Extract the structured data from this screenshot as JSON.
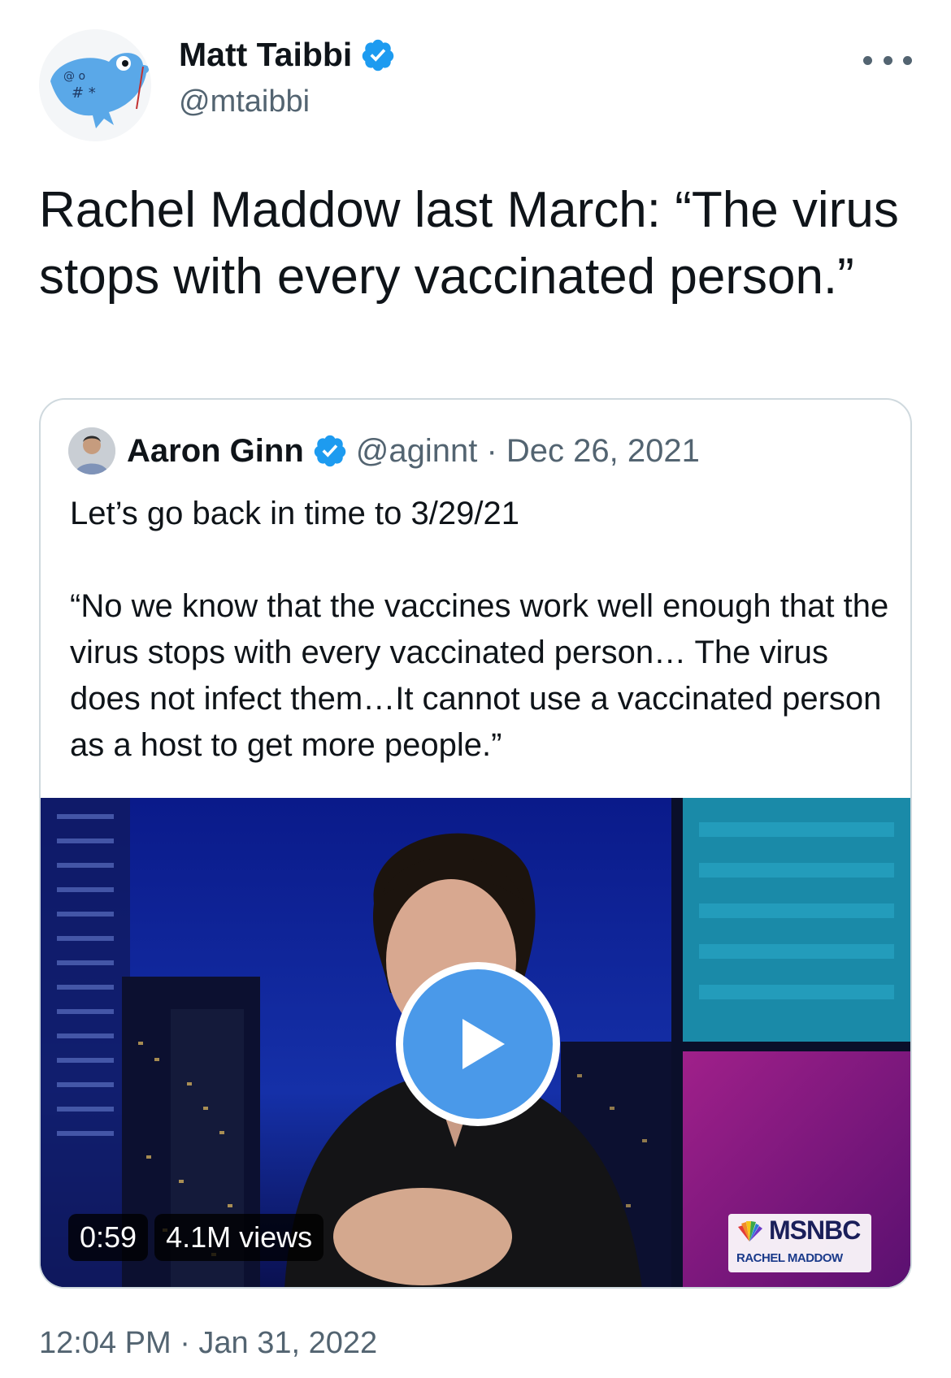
{
  "tweet": {
    "author": {
      "display_name": "Matt Taibbi",
      "handle": "@mtaibbi",
      "verified": true
    },
    "text": "Rachel Maddow last March: “The virus stops with every vaccinated person.”",
    "timestamp": "12:04 PM · Jan 31, 2022"
  },
  "quoted_tweet": {
    "author": {
      "display_name": "Aaron Ginn",
      "verified": true
    },
    "meta": "@aginnt · Dec 26, 2021",
    "text": "Let’s go back in time to 3/29/21\n\n“No we know that the vaccines work well enough that the virus stops with every vaccinated person… The virus does not infect them…It cannot use a vaccinated person as a host to get more people.”",
    "video": {
      "duration": "0:59",
      "views": "4.1M views",
      "network_logo": "MSNBC",
      "show_logo": "RACHEL MADDOW"
    }
  },
  "colors": {
    "verified": "#1d9bf0",
    "play_button": "#4a99e9",
    "secondary_text": "#536471",
    "border": "#cfd9de"
  }
}
